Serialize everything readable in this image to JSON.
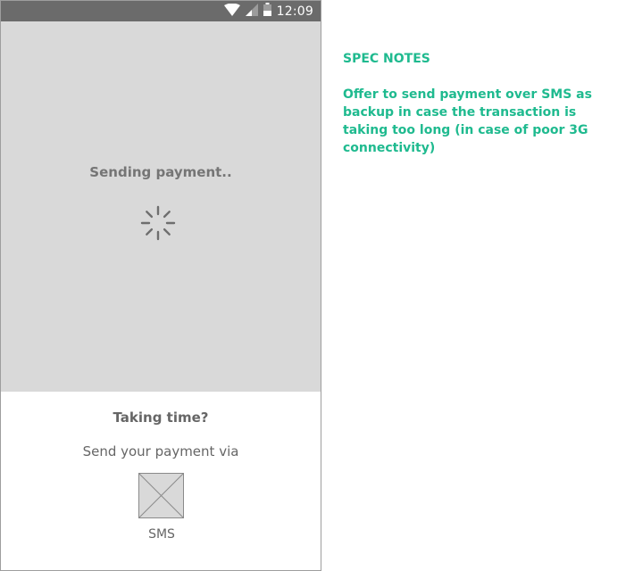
{
  "status_bar": {
    "time": "12:09",
    "icons": [
      "wifi-icon",
      "signal-icon",
      "battery-icon"
    ]
  },
  "loading": {
    "message": "Sending payment..",
    "spinner_icon": "loading-spinner-icon"
  },
  "fallback": {
    "title": "Taking time?",
    "subtitle": "Send your payment via",
    "options": [
      {
        "label": "SMS",
        "icon": "image-placeholder-icon"
      }
    ]
  },
  "spec": {
    "heading": "SPEC NOTES",
    "body": "Offer to send payment over SMS as backup in case the transaction is taking too long (in case of poor 3G connectivity)"
  },
  "colors": {
    "status_bar": "#6b6b6b",
    "loading_bg": "#d9d9d9",
    "spec_accent": "#1fba8f",
    "text_gray": "#666666"
  }
}
